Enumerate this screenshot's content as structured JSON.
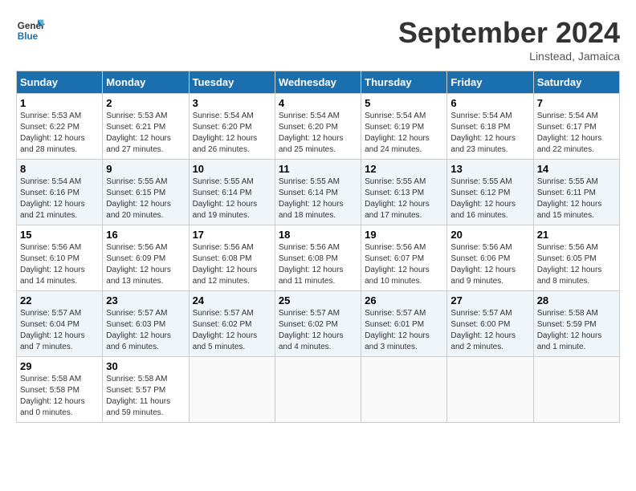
{
  "header": {
    "logo_line1": "General",
    "logo_line2": "Blue",
    "month_title": "September 2024",
    "location": "Linstead, Jamaica"
  },
  "weekdays": [
    "Sunday",
    "Monday",
    "Tuesday",
    "Wednesday",
    "Thursday",
    "Friday",
    "Saturday"
  ],
  "weeks": [
    [
      {
        "day": "1",
        "info": "Sunrise: 5:53 AM\nSunset: 6:22 PM\nDaylight: 12 hours\nand 28 minutes."
      },
      {
        "day": "2",
        "info": "Sunrise: 5:53 AM\nSunset: 6:21 PM\nDaylight: 12 hours\nand 27 minutes."
      },
      {
        "day": "3",
        "info": "Sunrise: 5:54 AM\nSunset: 6:20 PM\nDaylight: 12 hours\nand 26 minutes."
      },
      {
        "day": "4",
        "info": "Sunrise: 5:54 AM\nSunset: 6:20 PM\nDaylight: 12 hours\nand 25 minutes."
      },
      {
        "day": "5",
        "info": "Sunrise: 5:54 AM\nSunset: 6:19 PM\nDaylight: 12 hours\nand 24 minutes."
      },
      {
        "day": "6",
        "info": "Sunrise: 5:54 AM\nSunset: 6:18 PM\nDaylight: 12 hours\nand 23 minutes."
      },
      {
        "day": "7",
        "info": "Sunrise: 5:54 AM\nSunset: 6:17 PM\nDaylight: 12 hours\nand 22 minutes."
      }
    ],
    [
      {
        "day": "8",
        "info": "Sunrise: 5:54 AM\nSunset: 6:16 PM\nDaylight: 12 hours\nand 21 minutes."
      },
      {
        "day": "9",
        "info": "Sunrise: 5:55 AM\nSunset: 6:15 PM\nDaylight: 12 hours\nand 20 minutes."
      },
      {
        "day": "10",
        "info": "Sunrise: 5:55 AM\nSunset: 6:14 PM\nDaylight: 12 hours\nand 19 minutes."
      },
      {
        "day": "11",
        "info": "Sunrise: 5:55 AM\nSunset: 6:14 PM\nDaylight: 12 hours\nand 18 minutes."
      },
      {
        "day": "12",
        "info": "Sunrise: 5:55 AM\nSunset: 6:13 PM\nDaylight: 12 hours\nand 17 minutes."
      },
      {
        "day": "13",
        "info": "Sunrise: 5:55 AM\nSunset: 6:12 PM\nDaylight: 12 hours\nand 16 minutes."
      },
      {
        "day": "14",
        "info": "Sunrise: 5:55 AM\nSunset: 6:11 PM\nDaylight: 12 hours\nand 15 minutes."
      }
    ],
    [
      {
        "day": "15",
        "info": "Sunrise: 5:56 AM\nSunset: 6:10 PM\nDaylight: 12 hours\nand 14 minutes."
      },
      {
        "day": "16",
        "info": "Sunrise: 5:56 AM\nSunset: 6:09 PM\nDaylight: 12 hours\nand 13 minutes."
      },
      {
        "day": "17",
        "info": "Sunrise: 5:56 AM\nSunset: 6:08 PM\nDaylight: 12 hours\nand 12 minutes."
      },
      {
        "day": "18",
        "info": "Sunrise: 5:56 AM\nSunset: 6:08 PM\nDaylight: 12 hours\nand 11 minutes."
      },
      {
        "day": "19",
        "info": "Sunrise: 5:56 AM\nSunset: 6:07 PM\nDaylight: 12 hours\nand 10 minutes."
      },
      {
        "day": "20",
        "info": "Sunrise: 5:56 AM\nSunset: 6:06 PM\nDaylight: 12 hours\nand 9 minutes."
      },
      {
        "day": "21",
        "info": "Sunrise: 5:56 AM\nSunset: 6:05 PM\nDaylight: 12 hours\nand 8 minutes."
      }
    ],
    [
      {
        "day": "22",
        "info": "Sunrise: 5:57 AM\nSunset: 6:04 PM\nDaylight: 12 hours\nand 7 minutes."
      },
      {
        "day": "23",
        "info": "Sunrise: 5:57 AM\nSunset: 6:03 PM\nDaylight: 12 hours\nand 6 minutes."
      },
      {
        "day": "24",
        "info": "Sunrise: 5:57 AM\nSunset: 6:02 PM\nDaylight: 12 hours\nand 5 minutes."
      },
      {
        "day": "25",
        "info": "Sunrise: 5:57 AM\nSunset: 6:02 PM\nDaylight: 12 hours\nand 4 minutes."
      },
      {
        "day": "26",
        "info": "Sunrise: 5:57 AM\nSunset: 6:01 PM\nDaylight: 12 hours\nand 3 minutes."
      },
      {
        "day": "27",
        "info": "Sunrise: 5:57 AM\nSunset: 6:00 PM\nDaylight: 12 hours\nand 2 minutes."
      },
      {
        "day": "28",
        "info": "Sunrise: 5:58 AM\nSunset: 5:59 PM\nDaylight: 12 hours\nand 1 minute."
      }
    ],
    [
      {
        "day": "29",
        "info": "Sunrise: 5:58 AM\nSunset: 5:58 PM\nDaylight: 12 hours\nand 0 minutes."
      },
      {
        "day": "30",
        "info": "Sunrise: 5:58 AM\nSunset: 5:57 PM\nDaylight: 11 hours\nand 59 minutes."
      },
      {
        "day": "",
        "info": ""
      },
      {
        "day": "",
        "info": ""
      },
      {
        "day": "",
        "info": ""
      },
      {
        "day": "",
        "info": ""
      },
      {
        "day": "",
        "info": ""
      }
    ]
  ]
}
